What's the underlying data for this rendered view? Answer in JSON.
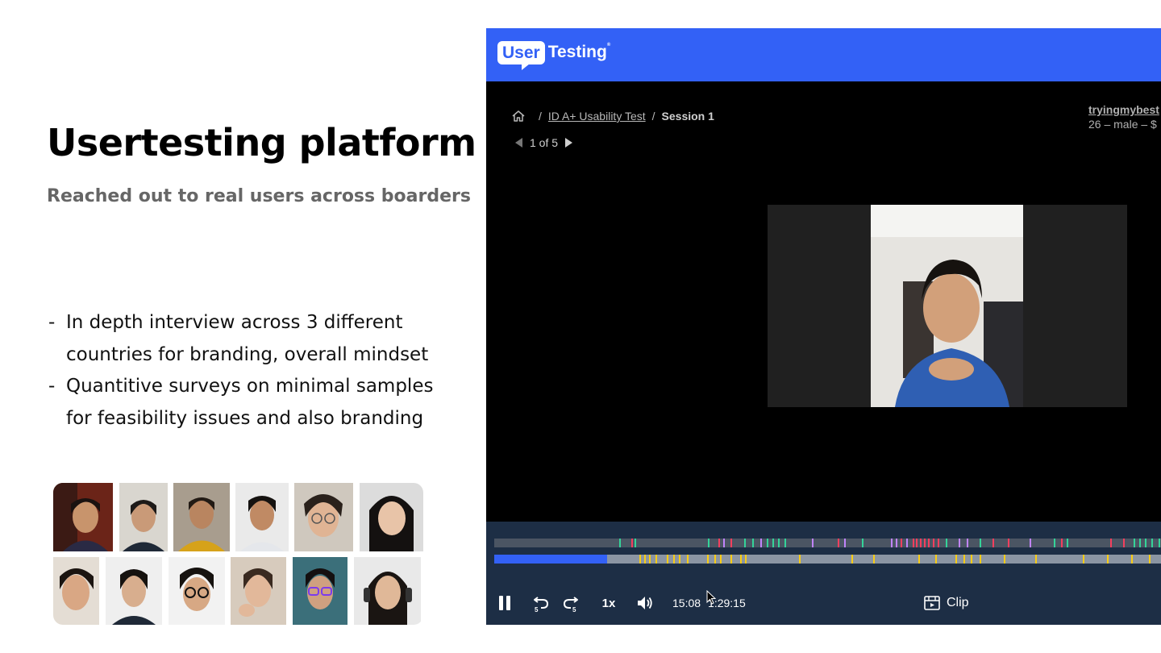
{
  "slide": {
    "title": "Usertesting platform",
    "subtitle": "Reached out to real users across boarders",
    "bullets": [
      "In depth interview across 3 different countries for branding, overall mindset",
      "Quantitive surveys on minimal samples for feasibility issues and also branding"
    ]
  },
  "app": {
    "logo": {
      "user": "User",
      "testing": "Testing",
      "reg": "®"
    },
    "breadcrumb": {
      "home_icon": "home-icon",
      "separator": "/",
      "study": "ID A+ Usability Test",
      "session": "Session 1"
    },
    "pager": {
      "text": "1 of 5"
    },
    "tester": {
      "name": "tryingmybest",
      "details": "26 – male – $"
    },
    "player": {
      "speed": "1x",
      "current_time": "15:08",
      "total_time": "1:29:15",
      "clip_label": "Clip",
      "progress_fraction": 0.169,
      "icons": [
        "pause-icon",
        "rewind-5-icon",
        "forward-5-icon",
        "volume-icon",
        "clip-icon"
      ]
    },
    "colors": {
      "brand_blue": "#3361f6",
      "controls_bg": "#1d2e45",
      "marker_green": "#34d399",
      "marker_red": "#f43f5e",
      "marker_purple": "#c084fc",
      "marker_yellow": "#facc15"
    }
  }
}
